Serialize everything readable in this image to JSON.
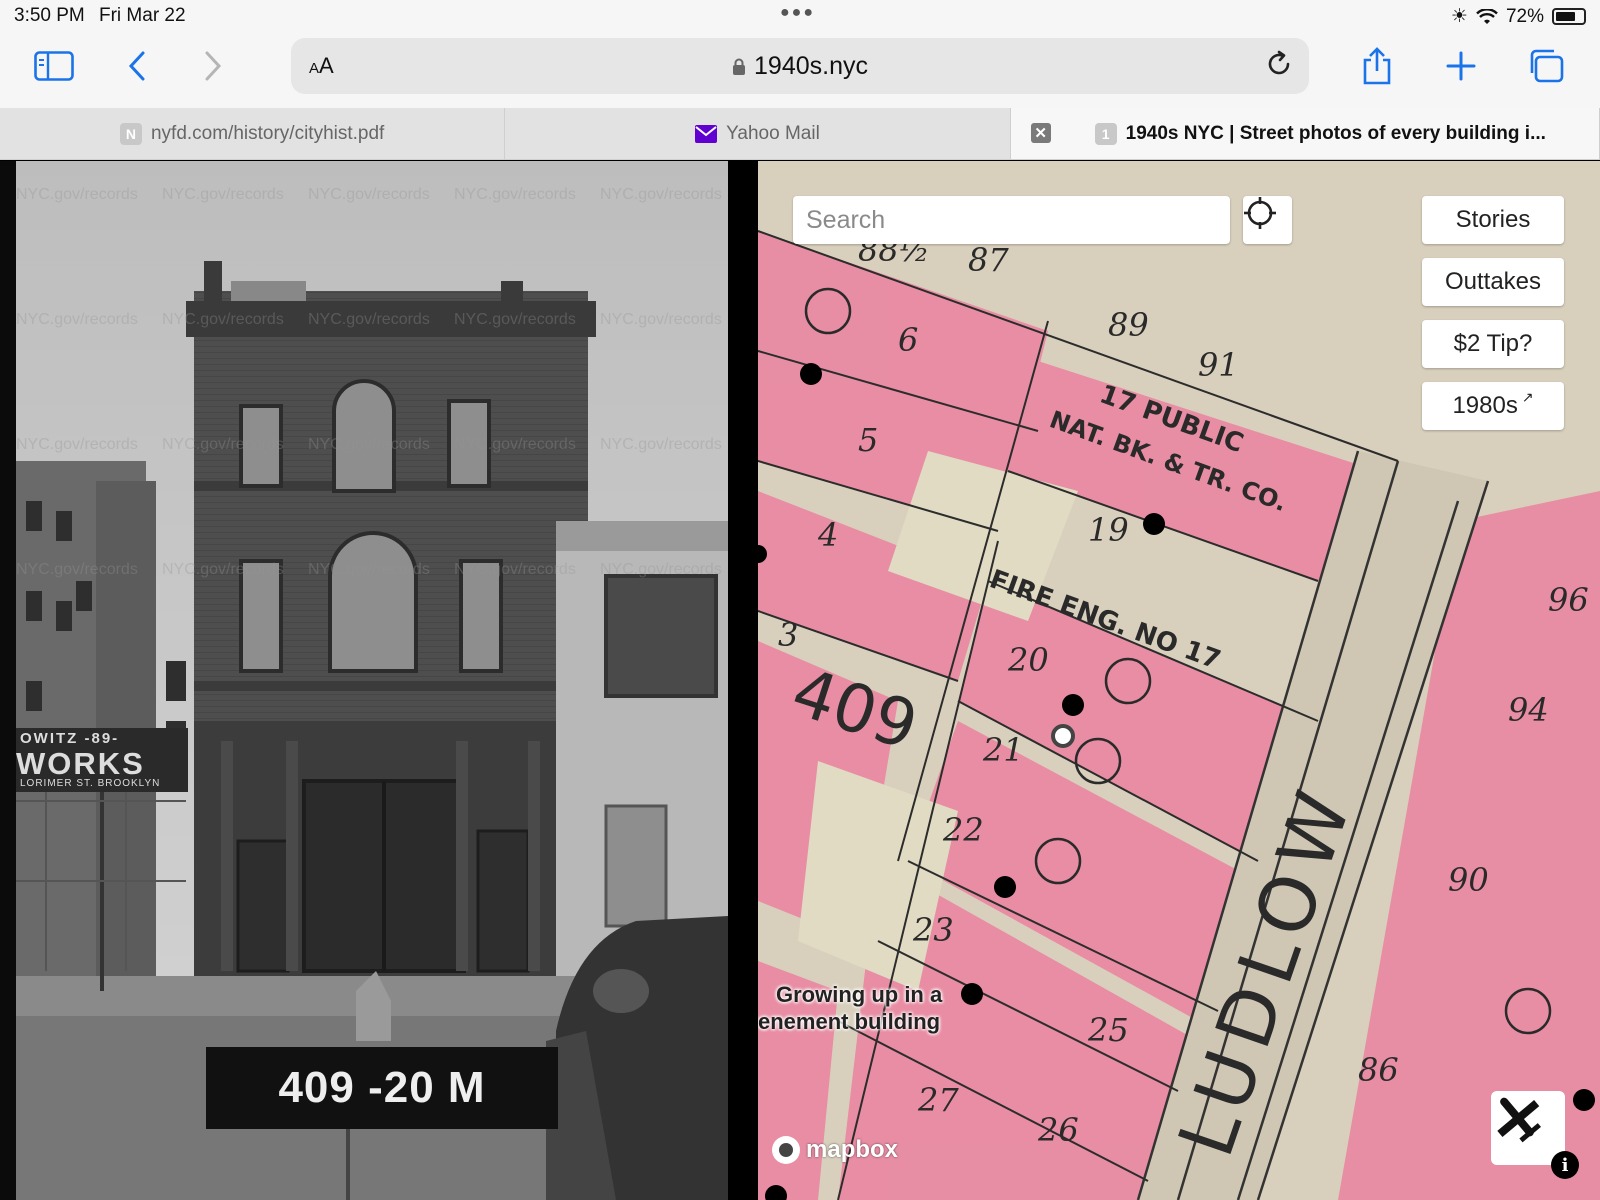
{
  "status_bar": {
    "time": "3:50 PM",
    "date": "Fri Mar 22",
    "battery": "72%",
    "battery_level": 0.72
  },
  "address_bar": {
    "reader_label_small": "A",
    "reader_label_large": "A",
    "url": "1940s.nyc"
  },
  "tabs": [
    {
      "favicon_letter": "N",
      "label": "nyfd.com/history/cityhist.pdf"
    },
    {
      "favicon_letter": "",
      "label": "Yahoo Mail"
    },
    {
      "favicon_letter": "1",
      "label": "1940s NYC | Street photos of every building i..."
    }
  ],
  "photo": {
    "watermark": "NYC.gov/records",
    "label": "409 -20 M",
    "sign_top": "OWITZ -89-",
    "sign_main": "WORKS",
    "sign_bottom": "LORIMER ST. BROOKLYN"
  },
  "map": {
    "search_placeholder": "Search",
    "buttons": {
      "stories": "Stories",
      "outtakes": "Outtakes",
      "tip": "$2 Tip?",
      "eighties": "1980s"
    },
    "story_label_line1": "Growing up in a",
    "story_label_line2": "enement building",
    "attribution": "mapbox",
    "street": "LUDLOW",
    "block": "409",
    "lot_labels": [
      "87",
      "88½",
      "89",
      "91",
      "6",
      "5",
      "4",
      "3",
      "19",
      "20",
      "21",
      "22",
      "23",
      "27",
      "26",
      "25",
      "17 PUBLIC",
      "NAT. BK. & TR. CO.",
      "FIRE ENG. NO 17",
      "96",
      "94",
      "90",
      "86"
    ]
  },
  "colors": {
    "accent": "#1a73e8",
    "map_pink": "#e77f9a",
    "map_paper": "#ddd6bf"
  }
}
